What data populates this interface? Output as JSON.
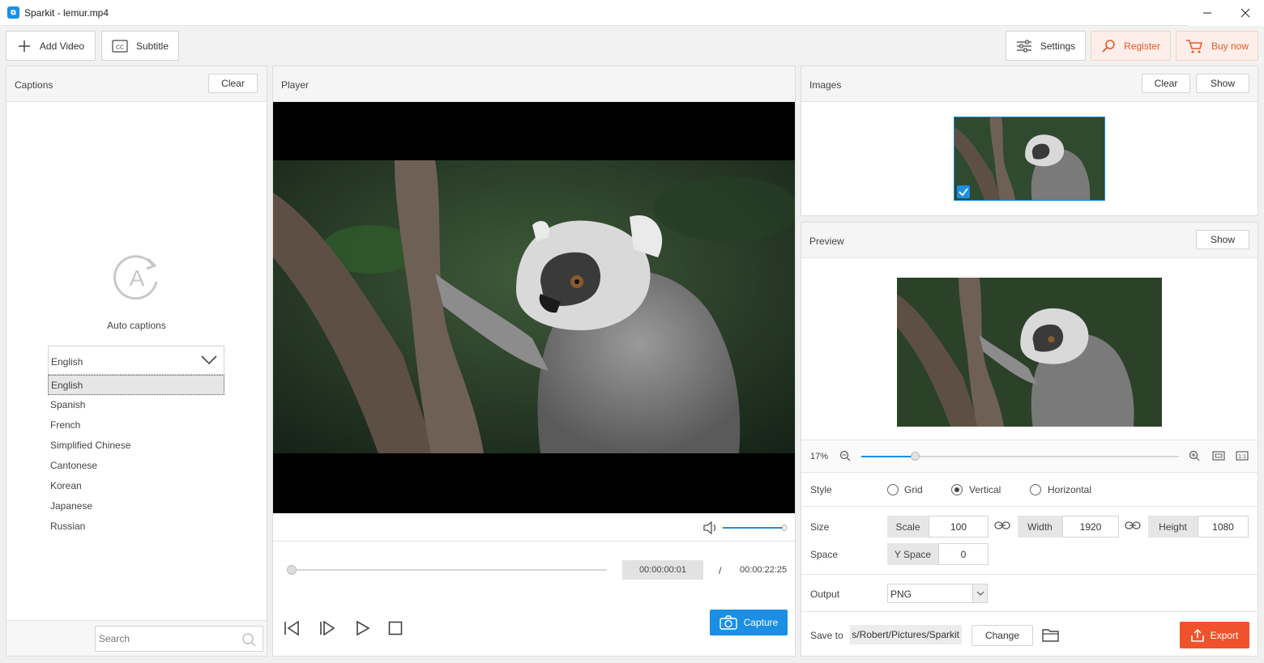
{
  "window": {
    "title": "Sparkit - lemur.mp4",
    "minimize": "—",
    "maximize": "☐",
    "close": "✕"
  },
  "toolbar": {
    "add_video": "Add Video",
    "subtitle": "Subtitle",
    "settings": "Settings",
    "register": "Register",
    "buy_now": "Buy now"
  },
  "captions": {
    "title": "Captions",
    "clear": "Clear",
    "auto_captions": "Auto captions",
    "selected_language": "English",
    "languages": [
      "English",
      "Spanish",
      "French",
      "Simplified Chinese",
      "Cantonese",
      "Korean",
      "Japanese",
      "Russian"
    ],
    "search_placeholder": "Search"
  },
  "player": {
    "title": "Player",
    "current_time": "00:00:00:01",
    "separator": "/",
    "total_time": "00:00:22:25",
    "capture": "Capture",
    "volume_level": 0.98,
    "progress": 0.0
  },
  "images": {
    "title": "Images",
    "clear": "Clear",
    "show": "Show"
  },
  "preview": {
    "title": "Preview",
    "show": "Show",
    "zoom_label": "17%",
    "zoom_level": 0.17
  },
  "settings": {
    "style_label": "Style",
    "style_options": [
      "Grid",
      "Vertical",
      "Horizontal"
    ],
    "style_selected": "Vertical",
    "size_label": "Size",
    "scale_label": "Scale",
    "scale_value": "100",
    "width_label": "Width",
    "width_value": "1920",
    "height_label": "Height",
    "height_value": "1080",
    "space_label": "Space",
    "yspace_label": "Y Space",
    "yspace_value": "0",
    "output_label": "Output",
    "output_value": "PNG",
    "save_to_label": "Save to",
    "save_path": "s/Robert/Pictures/Sparkit",
    "change": "Change",
    "export": "Export"
  },
  "colors": {
    "accent": "#1a8fe3",
    "orange": "#e85a2b",
    "export_bg": "#f0532b"
  }
}
